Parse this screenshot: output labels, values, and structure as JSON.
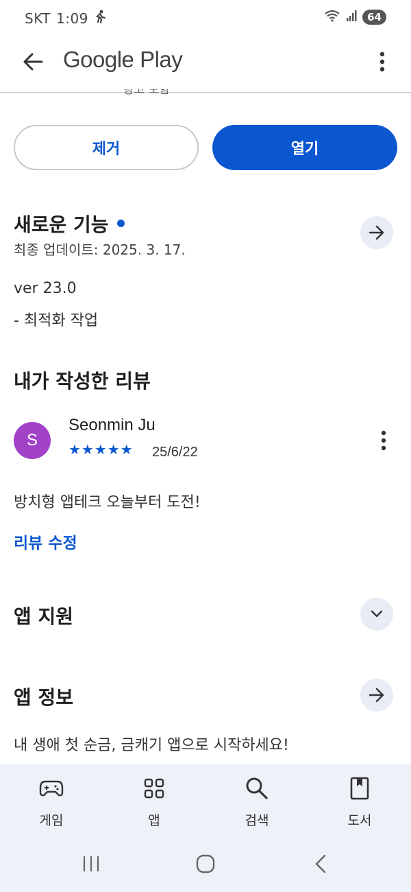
{
  "status_bar": {
    "carrier": "SKT",
    "time": "1:09",
    "battery": "64"
  },
  "app_bar": {
    "title": "Google Play"
  },
  "partial_text": "광고 포함",
  "actions": {
    "remove_label": "제거",
    "open_label": "열기"
  },
  "whats_new": {
    "title": "새로운 기능",
    "last_updated": "최종 업데이트: 2025. 3. 17.",
    "version": "ver 23.0",
    "notes": "- 최적화 작업"
  },
  "my_review": {
    "title": "내가 작성한 리뷰",
    "avatar_initial": "S",
    "reviewer_name": "Seonmin Ju",
    "rating": 5,
    "stars": "★★★★★",
    "date": "25/6/22",
    "text": "방치형 앱테크 오늘부터 도전!",
    "edit_label": "리뷰 수정"
  },
  "app_support": {
    "title": "앱 지원"
  },
  "app_info": {
    "title": "앱 정보",
    "description": "내 생애 첫 순금, 금캐기 앱으로 시작하세요!"
  },
  "bottom_nav": {
    "items": [
      {
        "label": "게임",
        "icon": "gamepad-icon"
      },
      {
        "label": "앱",
        "icon": "apps-grid-icon"
      },
      {
        "label": "검색",
        "icon": "search-icon"
      },
      {
        "label": "도서",
        "icon": "book-icon"
      }
    ]
  },
  "colors": {
    "accent": "#0b57d0",
    "avatar": "#a142c8",
    "nav_bg": "#eef1f8",
    "circle_btn": "#e8ecf4"
  }
}
